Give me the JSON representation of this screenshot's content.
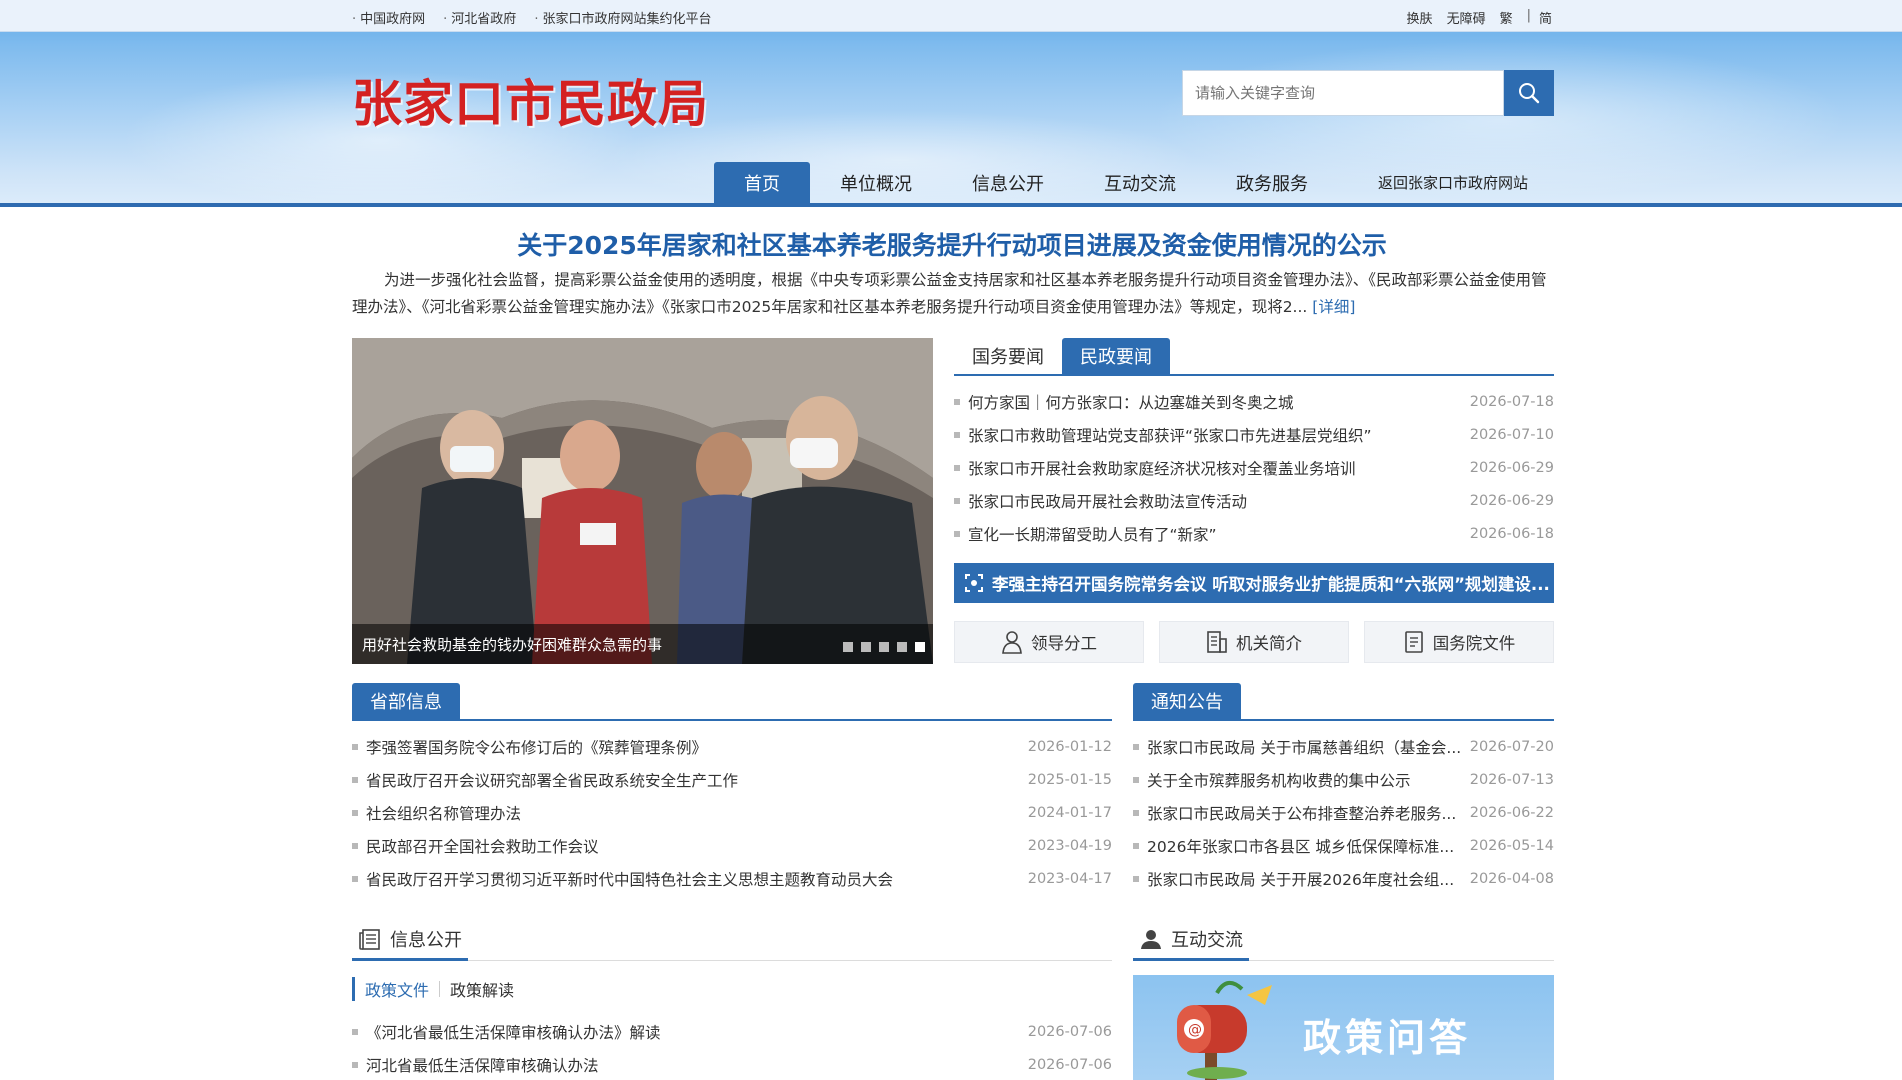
{
  "topbar": {
    "links": [
      "中国政府网",
      "河北省政府",
      "张家口市政府网站集约化平台"
    ],
    "skin": "换肤",
    "accessibility": "无障碍",
    "traditional": "繁",
    "simplified": "简"
  },
  "header": {
    "logo": "张家口市民政局",
    "search_placeholder": "请输入关键字查询"
  },
  "nav": {
    "items": [
      "首页",
      "单位概况",
      "信息公开",
      "互动交流",
      "政务服务"
    ],
    "back_link": "返回张家口市政府网站"
  },
  "headline": {
    "title": "关于2025年居家和社区基本养老服务提升行动项目进展及资金使用情况的公示",
    "summary": "为进一步强化社会监督，提高彩票公益金使用的透明度，根据《中央专项彩票公益金支持居家和社区基本养老服务提升行动项目资金管理办法》、《民政部彩票公益金使用管理办法》、《河北省彩票公益金管理实施办法》《张家口市2025年居家和社区基本养老服务提升行动项目资金使用管理办法》等规定，现将2...",
    "more": "[详细]"
  },
  "slider": {
    "caption": "用好社会救助基金的钱办好困难群众急需的事"
  },
  "news_tabs": [
    "国务要闻",
    "民政要闻"
  ],
  "news": [
    {
      "title": "何方家国｜何方张家口：从边塞雄关到冬奥之城",
      "date": "2026-07-18"
    },
    {
      "title": "张家口市救助管理站党支部获评“张家口市先进基层党组织”",
      "date": "2026-07-10"
    },
    {
      "title": "张家口市开展社会救助家庭经济状况核对全覆盖业务培训",
      "date": "2026-06-29"
    },
    {
      "title": "张家口市民政局开展社会救助法宣传活动",
      "date": "2026-06-29"
    },
    {
      "title": "宣化一长期滞留受助人员有了“新家”",
      "date": "2026-06-18"
    }
  ],
  "banner": "李强主持召开国务院常务会议 听取对服务业扩能提质和“六张网”规划建设...",
  "quick_links": [
    "领导分工",
    "机关简介",
    "国务院文件"
  ],
  "provincial": {
    "heading": "省部信息",
    "items": [
      {
        "title": "李强签署国务院令公布修订后的《殡葬管理条例》",
        "date": "2026-01-12"
      },
      {
        "title": "省民政厅召开会议研究部署全省民政系统安全生产工作",
        "date": "2025-01-15"
      },
      {
        "title": "社会组织名称管理办法",
        "date": "2024-01-17"
      },
      {
        "title": "民政部召开全国社会救助工作会议",
        "date": "2023-04-19"
      },
      {
        "title": "省民政厅召开学习贯彻习近平新时代中国特色社会主义思想主题教育动员大会",
        "date": "2023-04-17"
      }
    ]
  },
  "notices": {
    "heading": "通知公告",
    "items": [
      {
        "title": "张家口市民政局 关于市属慈善组织（基金会...",
        "date": "2026-07-20"
      },
      {
        "title": "关于全市殡葬服务机构收费的集中公示",
        "date": "2026-07-13"
      },
      {
        "title": "张家口市民政局关于公布排查整治养老服务...",
        "date": "2026-06-22"
      },
      {
        "title": "2026年张家口市各县区 城乡低保保障标准...",
        "date": "2026-05-14"
      },
      {
        "title": "张家口市民政局 关于开展2026年度社会组...",
        "date": "2026-04-08"
      }
    ]
  },
  "info_open": {
    "heading": "信息公开",
    "subtabs": [
      "政策文件",
      "政策解读"
    ],
    "items": [
      {
        "title": "《河北省最低生活保障审核确认办法》解读",
        "date": "2026-07-06"
      },
      {
        "title": "河北省最低生活保障审核确认办法",
        "date": "2026-07-06"
      }
    ]
  },
  "interaction": {
    "heading": "互动交流",
    "qa_banner": "政策问答"
  }
}
